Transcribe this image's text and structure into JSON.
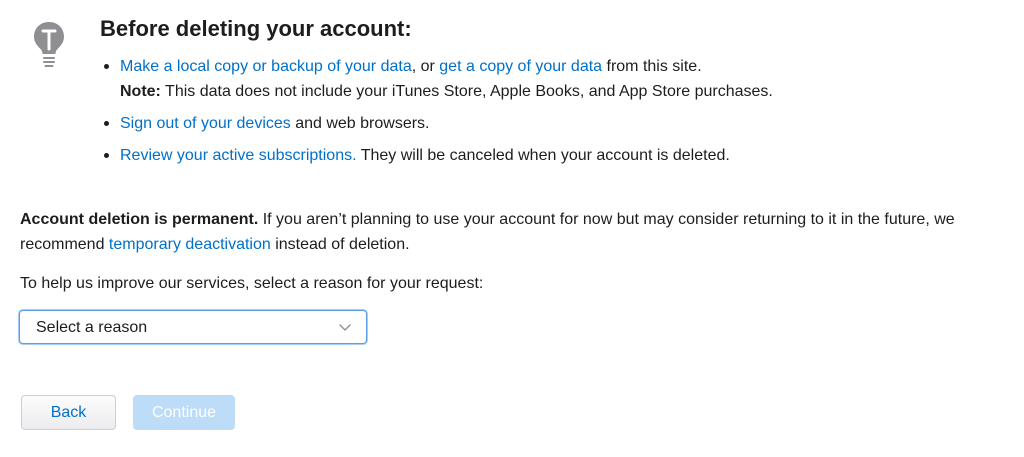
{
  "tips": {
    "icon": "lightbulb-icon",
    "heading": "Before deleting your account:",
    "item1": {
      "link1": "Make a local copy or backup of your data",
      "text1": ", or ",
      "link2": "get a copy of your data",
      "text2": " from this site.",
      "note_label": "Note:",
      "note_text": " This data does not include your iTunes Store, Apple Books, and App Store purchases."
    },
    "item2": {
      "link": "Sign out of your devices",
      "text": " and web browsers."
    },
    "item3": {
      "link": "Review your active subscriptions.",
      "text": " They will be canceled when your account is deleted."
    }
  },
  "permanent": {
    "strong": "Account deletion is permanent.",
    "text1": " If you aren’t planning to use your account for now but may consider returning to it in the future, we recommend ",
    "link": "temporary deactivation",
    "text2": " instead of deletion."
  },
  "reason": {
    "prompt": "To help us improve our services, select a reason for your request:",
    "selected": "Select a reason"
  },
  "buttons": {
    "back": "Back",
    "continue": "Continue"
  },
  "colors": {
    "link": "#0070c9",
    "icon": "#8e8e93",
    "continue_disabled": "#bcdcf7"
  }
}
